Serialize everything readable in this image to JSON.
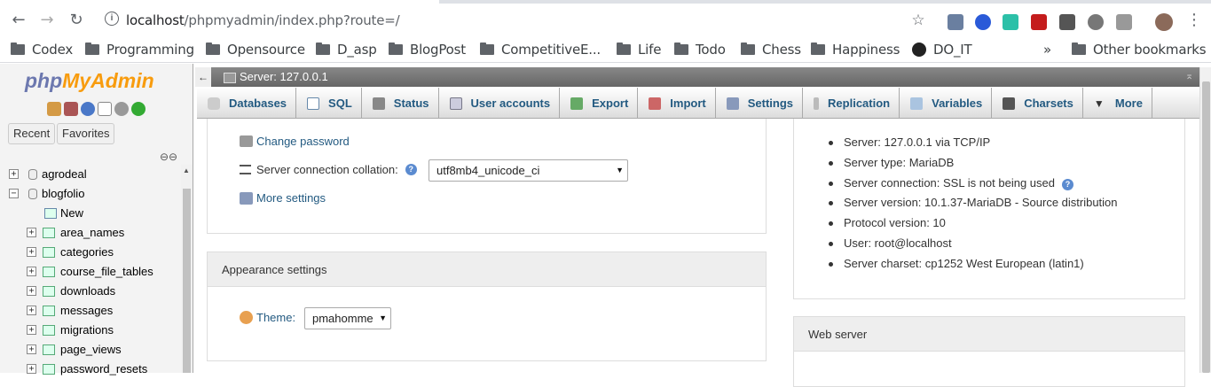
{
  "browser": {
    "url_host": "localhost",
    "url_path": "/phpmyadmin/index.php?route=/",
    "bookmarks": [
      "Codex",
      "Programming",
      "Opensource",
      "D_asp",
      "BlogPost",
      "CompetitiveE...",
      "Life",
      "Todo",
      "Chess",
      "Happiness",
      "DO_IT"
    ],
    "overflow": "»",
    "other_bookmarks": "Other bookmarks"
  },
  "nav": {
    "logo_php": "php",
    "logo_my": "My",
    "logo_admin": "Admin",
    "recent": "Recent",
    "favorites": "Favorites",
    "tree": [
      {
        "label": "agrodeal",
        "exp": "+"
      },
      {
        "label": "blogfolio",
        "exp": "−"
      },
      {
        "label": "New"
      },
      {
        "label": "area_names",
        "exp": "+"
      },
      {
        "label": "categories",
        "exp": "+"
      },
      {
        "label": "course_file_tables",
        "exp": "+"
      },
      {
        "label": "downloads",
        "exp": "+"
      },
      {
        "label": "messages",
        "exp": "+"
      },
      {
        "label": "migrations",
        "exp": "+"
      },
      {
        "label": "page_views",
        "exp": "+"
      },
      {
        "label": "password_resets",
        "exp": "+"
      }
    ]
  },
  "server": {
    "title": "Server: 127.0.0.1"
  },
  "tabs": [
    "Databases",
    "SQL",
    "Status",
    "User accounts",
    "Export",
    "Import",
    "Settings",
    "Replication",
    "Variables",
    "Charsets",
    "More"
  ],
  "general": {
    "change_password": "Change password",
    "collation_label": "Server connection collation:",
    "collation_value": "utf8mb4_unicode_ci",
    "more_settings": "More settings"
  },
  "appearance": {
    "heading": "Appearance settings",
    "theme_label": "Theme:",
    "theme_value": "pmahomme"
  },
  "db_server": {
    "items": [
      "Server: 127.0.0.1 via TCP/IP",
      "Server type: MariaDB",
      "Server connection: SSL is not being used",
      "Server version: 10.1.37-MariaDB - Source distribution",
      "Protocol version: 10",
      "User: root@localhost",
      "Server charset: cp1252 West European (latin1)"
    ]
  },
  "web_server": {
    "heading": "Web server"
  }
}
